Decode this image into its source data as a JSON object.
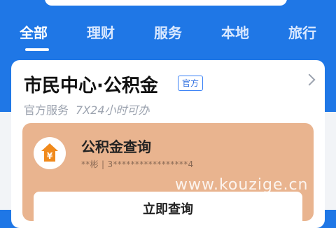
{
  "tabs": [
    {
      "label": "全部",
      "active": true
    },
    {
      "label": "理财",
      "active": false
    },
    {
      "label": "服务",
      "active": false
    },
    {
      "label": "本地",
      "active": false
    },
    {
      "label": "旅行",
      "active": false
    }
  ],
  "card": {
    "title": "市民中心·公积金",
    "badge": "官方",
    "subtitle": "官方服务",
    "hours": "7X24小时可办",
    "service": {
      "name": "公积金查询",
      "meta": "**彬 | 3*****************4",
      "icon": "house-yen-icon",
      "button_label": "立即查询"
    }
  },
  "watermark": "www.kouzige.cn",
  "colors": {
    "header_blue": "#1f77e6",
    "panel_peach": "#e9b48f",
    "icon_orange": "#f08a1c"
  }
}
